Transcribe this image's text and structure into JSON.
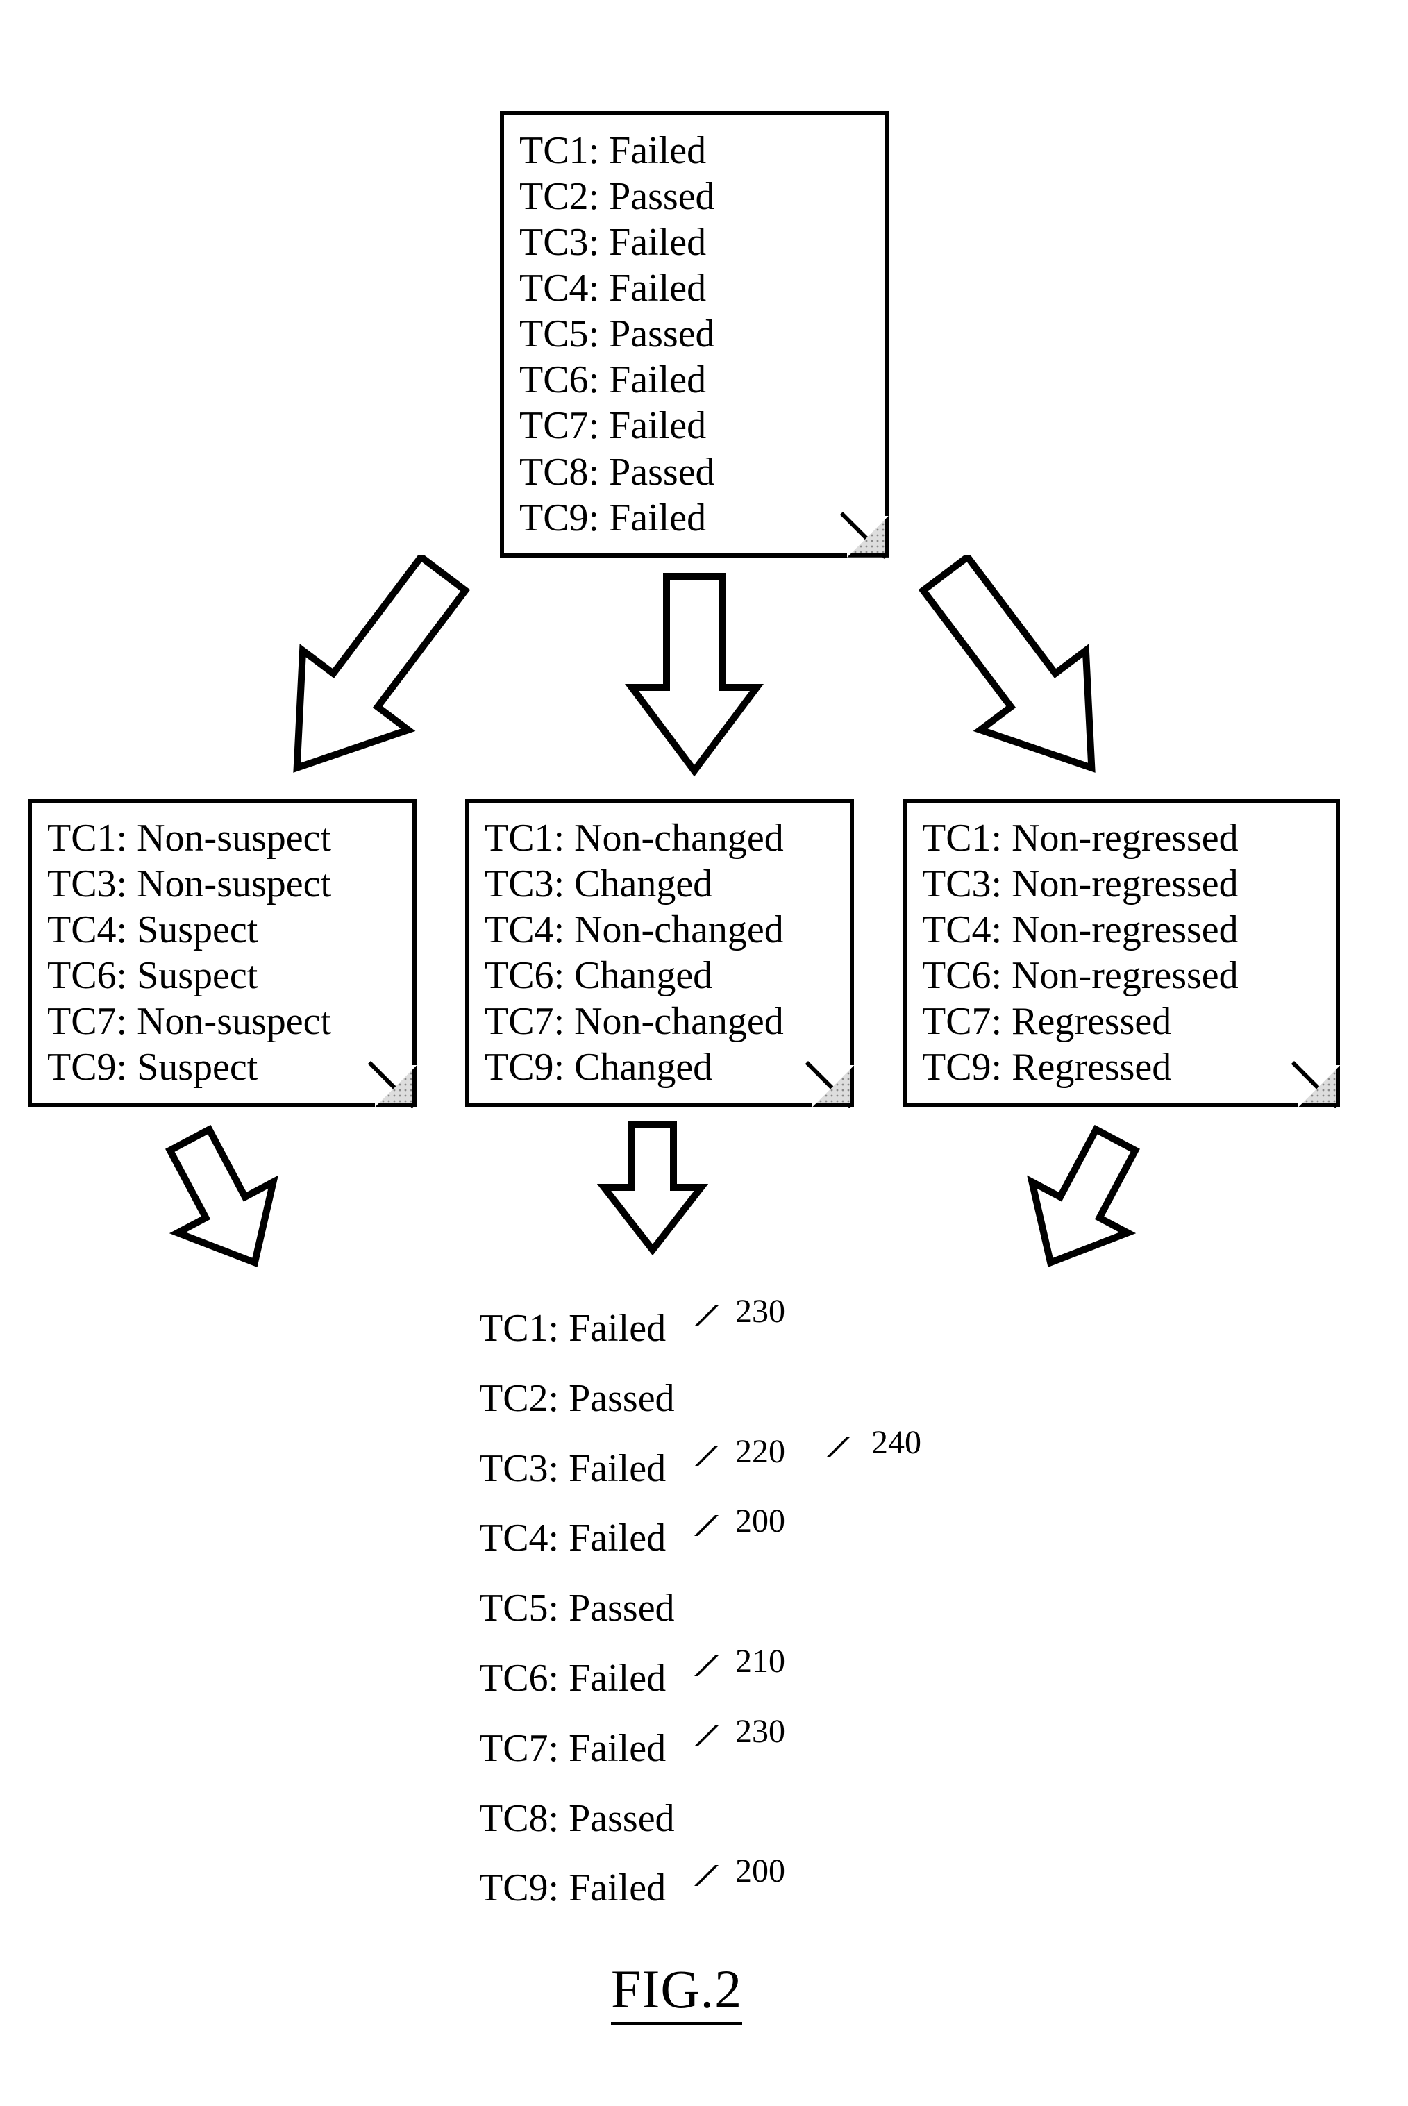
{
  "figure_label": "FIG.2",
  "top_doc": {
    "rows": [
      {
        "id": "TC1",
        "status": "Failed"
      },
      {
        "id": "TC2",
        "status": "Passed"
      },
      {
        "id": "TC3",
        "status": "Failed"
      },
      {
        "id": "TC4",
        "status": "Failed"
      },
      {
        "id": "TC5",
        "status": "Passed"
      },
      {
        "id": "TC6",
        "status": "Failed"
      },
      {
        "id": "TC7",
        "status": "Failed"
      },
      {
        "id": "TC8",
        "status": "Passed"
      },
      {
        "id": "TC9",
        "status": "Failed"
      }
    ]
  },
  "left_doc": {
    "rows": [
      {
        "id": "TC1",
        "status": "Non-suspect"
      },
      {
        "id": "TC3",
        "status": "Non-suspect"
      },
      {
        "id": "TC4",
        "status": "Suspect"
      },
      {
        "id": "TC6",
        "status": "Suspect"
      },
      {
        "id": "TC7",
        "status": "Non-suspect"
      },
      {
        "id": "TC9",
        "status": "Suspect"
      }
    ]
  },
  "center_doc": {
    "rows": [
      {
        "id": "TC1",
        "status": "Non-changed"
      },
      {
        "id": "TC3",
        "status": "Changed"
      },
      {
        "id": "TC4",
        "status": "Non-changed"
      },
      {
        "id": "TC6",
        "status": "Changed"
      },
      {
        "id": "TC7",
        "status": "Non-changed"
      },
      {
        "id": "TC9",
        "status": "Changed"
      }
    ]
  },
  "right_doc": {
    "rows": [
      {
        "id": "TC1",
        "status": "Non-regressed"
      },
      {
        "id": "TC3",
        "status": "Non-regressed"
      },
      {
        "id": "TC4",
        "status": "Non-regressed"
      },
      {
        "id": "TC6",
        "status": "Non-regressed"
      },
      {
        "id": "TC7",
        "status": "Regressed"
      },
      {
        "id": "TC9",
        "status": "Regressed"
      }
    ]
  },
  "result_list": {
    "rows": [
      {
        "id": "TC1",
        "status": "Failed",
        "ref": "230"
      },
      {
        "id": "TC2",
        "status": "Passed",
        "ref": null
      },
      {
        "id": "TC3",
        "status": "Failed",
        "ref": "220"
      },
      {
        "id": "TC4",
        "status": "Failed",
        "ref": "200"
      },
      {
        "id": "TC5",
        "status": "Passed",
        "ref": null
      },
      {
        "id": "TC6",
        "status": "Failed",
        "ref": "210"
      },
      {
        "id": "TC7",
        "status": "Failed",
        "ref": "230"
      },
      {
        "id": "TC8",
        "status": "Passed",
        "ref": null
      },
      {
        "id": "TC9",
        "status": "Failed",
        "ref": "200"
      }
    ]
  },
  "floating_ref": "240"
}
